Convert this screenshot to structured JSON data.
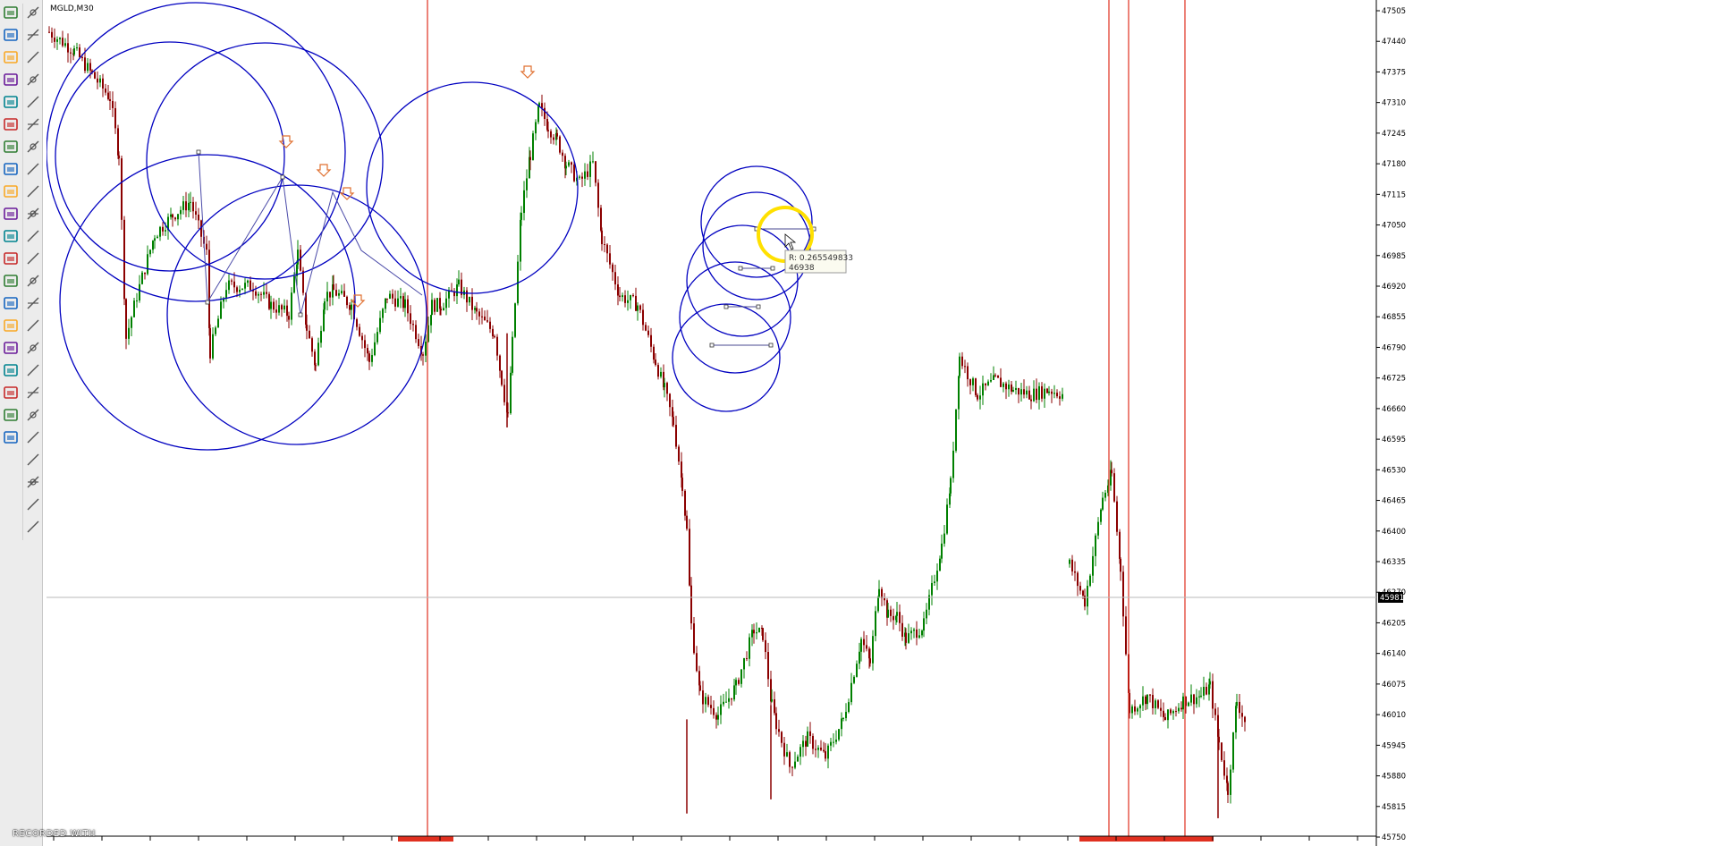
{
  "chart": {
    "symbol_label": "MGLD,M30",
    "price_scale": [
      "47505",
      "47440",
      "47375",
      "47310",
      "47245",
      "47180",
      "47115",
      "47050",
      "46985",
      "46920",
      "46855",
      "46790",
      "46725",
      "46660",
      "46595",
      "46530",
      "46465",
      "46400",
      "46335",
      "46270",
      "46205",
      "46140",
      "46075",
      "46010",
      "45945",
      "45880",
      "45815",
      "45750"
    ],
    "current_price_label": "45981",
    "cursor_tooltip": {
      "line1": "R: 0.265549833",
      "line2": "46938"
    },
    "colors": {
      "circle": "#0000c0",
      "vertical_line": "#e03020",
      "bull_candle": "#008000",
      "bear_candle": "#8b0000",
      "fractal_arrow": "#e07030",
      "price_axis_bg": "#ffffff",
      "current_price_bg": "#000000",
      "highlight": "#ffe000"
    }
  },
  "toolbar": {
    "left_icons": [
      "new-chart-icon",
      "profiles-icon",
      "market-watch-icon",
      "navigator-icon",
      "terminal-icon",
      "strategy-tester-icon",
      "data-window-icon",
      "new-order-icon",
      "metaeditor-icon",
      "bar-chart-icon",
      "candlestick-icon",
      "line-chart-icon",
      "zoom-in-icon",
      "zoom-out-icon",
      "tile-windows-icon",
      "autoscroll-icon",
      "chart-shift-icon",
      "indicators-icon",
      "periods-icon",
      "templates-icon"
    ],
    "right_icons": [
      "cursor-icon",
      "crosshair-icon",
      "vertical-line-icon",
      "horizontal-line-icon",
      "trendline-icon",
      "equidistant-channel-icon",
      "fibonacci-icon",
      "text-icon",
      "text-label-icon",
      "rectangle-icon",
      "andrews-pitchfork-icon",
      "gann-fan-icon",
      "gann-grid-icon",
      "fibo-fan-icon",
      "fibo-arcs-icon",
      "fibo-timezones-icon",
      "cycle-lines-icon",
      "linear-regression-icon",
      "standard-deviation-icon",
      "arrow-icon",
      "ellipse-icon",
      "triangle-icon",
      "fibo-expansion-icon",
      "more-tools-icon"
    ]
  },
  "watermark": "RECORDED WITH"
}
